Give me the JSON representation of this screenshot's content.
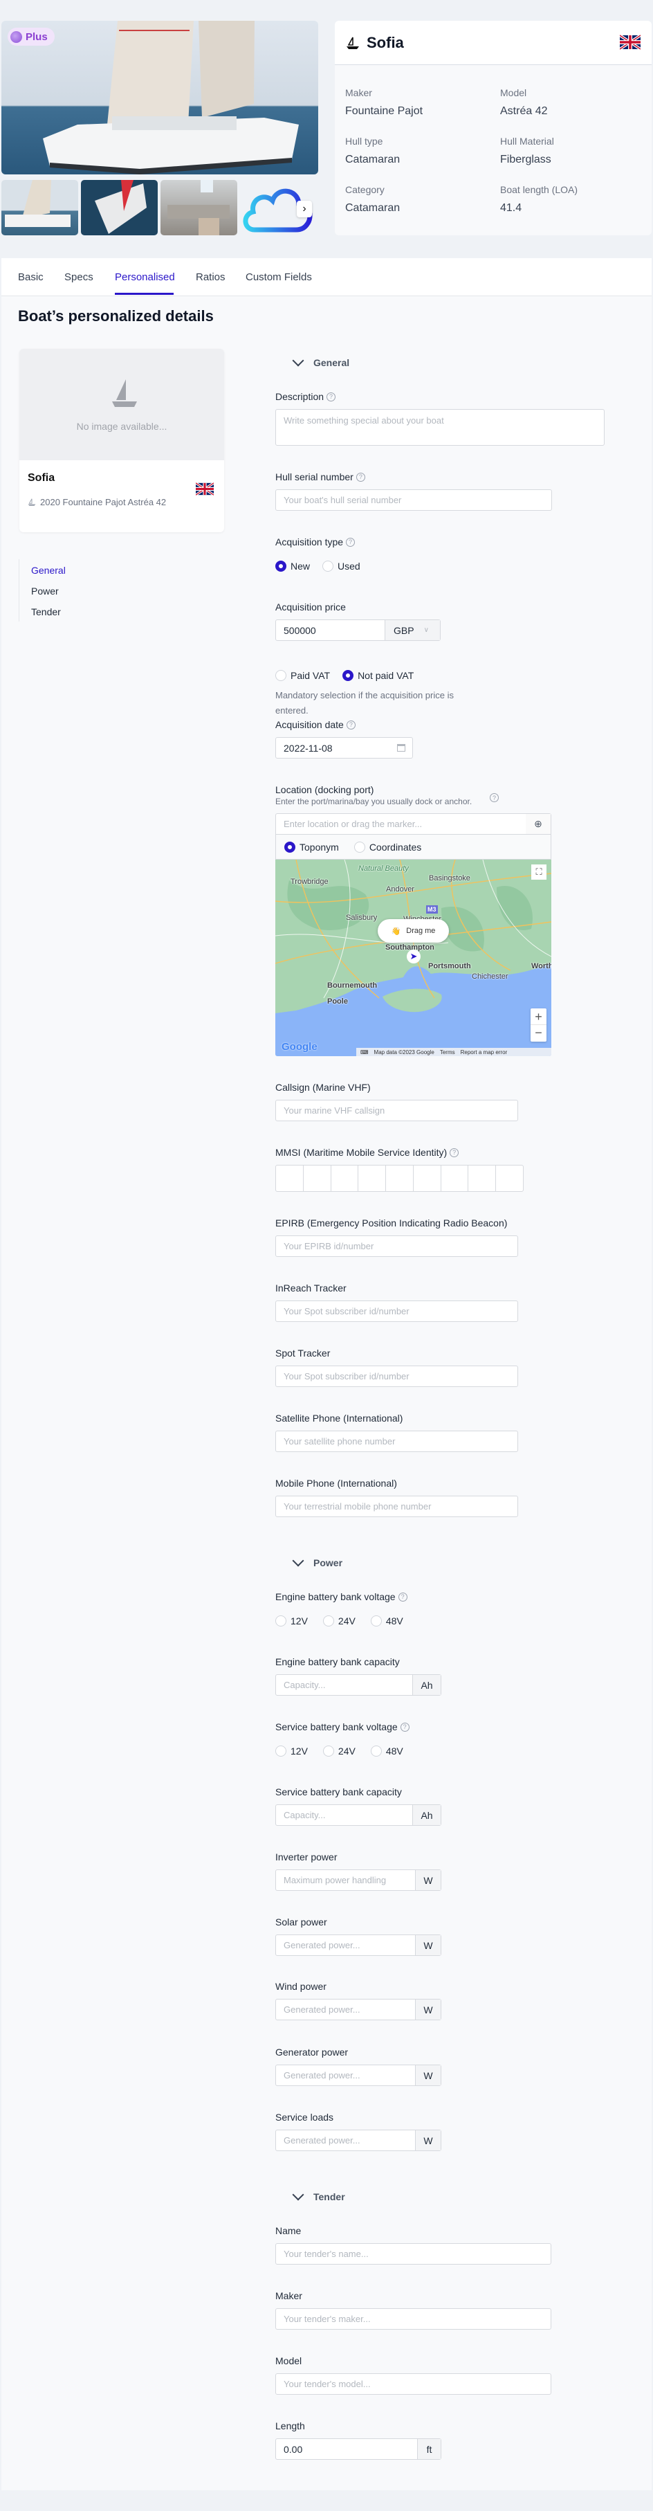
{
  "hero": {
    "badge": "Plus",
    "next_icon": "chevron-right-icon"
  },
  "boat": {
    "name": "Sofia",
    "flag": "united-kingdom-flag",
    "fields": [
      {
        "label": "Maker",
        "value": "Fountaine Pajot"
      },
      {
        "label": "Model",
        "value": "Astréa 42"
      },
      {
        "label": "Hull type",
        "value": "Catamaran"
      },
      {
        "label": "Hull Material",
        "value": "Fiberglass"
      },
      {
        "label": "Category",
        "value": "Catamaran"
      },
      {
        "label": "Boat length (LOA)",
        "value": "41.4"
      }
    ]
  },
  "tabs": [
    {
      "label": "Basic"
    },
    {
      "label": "Specs"
    },
    {
      "label": "Personalised",
      "active": true
    },
    {
      "label": "Ratios"
    },
    {
      "label": "Custom Fields"
    }
  ],
  "page_title": "Boat’s personalized details",
  "side_card": {
    "no_image": "No image available...",
    "name": "Sofia",
    "subtitle": "2020 Fountaine Pajot Astréa 42"
  },
  "side_nav": [
    {
      "label": "General",
      "active": true
    },
    {
      "label": "Power"
    },
    {
      "label": "Tender"
    }
  ],
  "colors": {
    "accent": "#2b17c9",
    "page_bg": "#eff2f6"
  },
  "general": {
    "title": "General",
    "description": {
      "label": "Description",
      "placeholder": "Write something special about your boat"
    },
    "hull_serial": {
      "label": "Hull serial number",
      "placeholder": "Your boat's hull serial number"
    },
    "acquisition_type": {
      "label": "Acquisition type",
      "options": [
        "New",
        "Used"
      ],
      "selected": "New"
    },
    "acquisition_price": {
      "label": "Acquisition price",
      "value": "500000",
      "currency": "GBP"
    },
    "vat": {
      "options": [
        "Paid VAT",
        "Not paid VAT"
      ],
      "selected": "Not paid VAT",
      "help": "Mandatory selection if the acquisition price is entered."
    },
    "acquisition_date": {
      "label": "Acquisition date",
      "value": "2022-11-08"
    },
    "location": {
      "label": "Location (docking port)",
      "sub": "Enter the port/marina/bay you usually dock or anchor.",
      "placeholder": "Enter location or drag the marker...",
      "modes": [
        "Toponym",
        "Coordinates"
      ],
      "selected_mode": "Toponym"
    },
    "callsign": {
      "label": "Callsign (Marine VHF)",
      "placeholder": "Your marine VHF callsign"
    },
    "mmsi": {
      "label": "MMSI (Maritime Mobile Service Identity)",
      "digits": 9
    },
    "epirb": {
      "label": "EPIRB (Emergency Position Indicating Radio Beacon)",
      "placeholder": "Your EPIRB id/number"
    },
    "inreach": {
      "label": "InReach Tracker",
      "placeholder": "Your Spot subscriber id/number"
    },
    "spot": {
      "label": "Spot Tracker",
      "placeholder": "Your Spot subscriber id/number"
    },
    "satphone": {
      "label": "Satellite Phone (International)",
      "placeholder": "Your satellite phone number"
    },
    "mobile": {
      "label": "Mobile Phone (International)",
      "placeholder": "Your terrestrial mobile phone number"
    }
  },
  "map": {
    "labels": [
      "Natural Beauty",
      "Trowbridge",
      "Andover",
      "Basingstoke",
      "Salisbury",
      "Winchester",
      "Southampton",
      "Portsmouth",
      "Chichester",
      "Bournemouth",
      "Poole",
      "Worthi",
      "M3"
    ],
    "drag": "Drag me",
    "attribution": "Map data ©2023 Google",
    "terms": "Terms",
    "report": "Report a map error",
    "logo": "Google"
  },
  "power": {
    "title": "Power",
    "engine_voltage": {
      "label": "Engine battery bank voltage",
      "options": [
        "12V",
        "24V",
        "48V"
      ]
    },
    "engine_capacity": {
      "label": "Engine battery bank capacity",
      "placeholder": "Capacity...",
      "unit": "Ah"
    },
    "service_voltage": {
      "label": "Service battery bank voltage",
      "options": [
        "12V",
        "24V",
        "48V"
      ]
    },
    "service_capacity": {
      "label": "Service battery bank capacity",
      "placeholder": "Capacity...",
      "unit": "Ah"
    },
    "inverter": {
      "label": "Inverter power",
      "placeholder": "Maximum power handling",
      "unit": "W"
    },
    "solar": {
      "label": "Solar power",
      "placeholder": "Generated power...",
      "unit": "W"
    },
    "wind": {
      "label": "Wind power",
      "placeholder": "Generated power...",
      "unit": "W"
    },
    "generator": {
      "label": "Generator power",
      "placeholder": "Generated power...",
      "unit": "W"
    },
    "loads": {
      "label": "Service loads",
      "placeholder": "Generated power...",
      "unit": "W"
    }
  },
  "tender": {
    "title": "Tender",
    "name": {
      "label": "Name",
      "placeholder": "Your tender's name..."
    },
    "maker": {
      "label": "Maker",
      "placeholder": "Your tender's maker..."
    },
    "model": {
      "label": "Model",
      "placeholder": "Your tender's model..."
    },
    "length": {
      "label": "Length",
      "value": "0.00",
      "unit": "ft"
    }
  }
}
